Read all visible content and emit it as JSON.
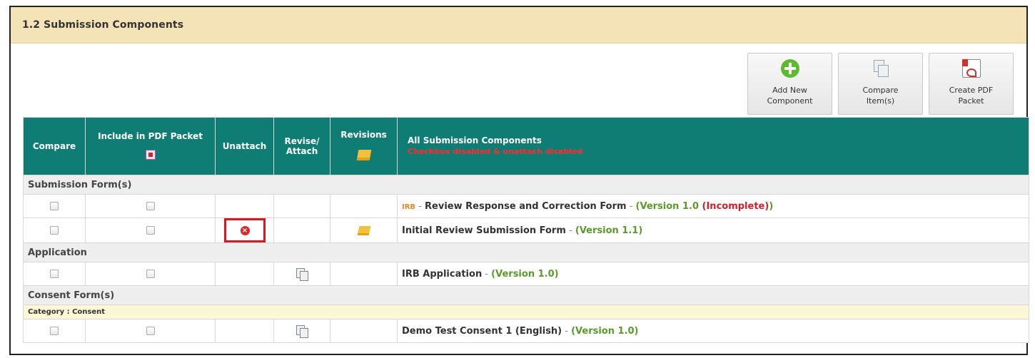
{
  "panel": {
    "title": "1.2  Submission Components"
  },
  "toolbar": {
    "add_new": "Add New Component",
    "compare": "Compare Item(s)",
    "create_pdf": "Create PDF Packet"
  },
  "table": {
    "headers": {
      "compare": "Compare",
      "include_pdf": "Include in PDF Packet",
      "unattach": "Unattach",
      "revise": "Revise/ Attach",
      "revisions": "Revisions",
      "all": "All Submission Components",
      "all_warning": "Checkbox disabled & unattach disabled"
    },
    "sections": [
      {
        "label": "Submission Form(s)"
      },
      {
        "label": "Application"
      },
      {
        "label": "Consent Form(s)"
      }
    ],
    "category_label": "Category : Consent",
    "rows": [
      {
        "tag": "IRB",
        "sep": " - ",
        "name": "Review Response and Correction Form",
        "version": "(Version 1.0",
        "status": "(Incomplete)",
        "close": ")"
      },
      {
        "name": "Initial Review Submission Form",
        "sep": " - ",
        "version": "(Version 1.1)"
      },
      {
        "name": "IRB Application",
        "sep": " - ",
        "version": "(Version 1.0)"
      },
      {
        "name": "Demo Test Consent 1 (English)",
        "sep": " - ",
        "version": "(Version 1.0)"
      }
    ]
  },
  "icons": {
    "add": "plus-circle-icon",
    "compare": "compare-pages-icon",
    "pdf": "pdf-file-icon",
    "unattach": "remove-x-icon",
    "revisions": "folder-icon",
    "revise": "revise-pages-icon"
  },
  "colors": {
    "header_bg": "#f3e3b6",
    "table_head": "#0f7d74",
    "version": "#5a9a2a",
    "incomplete": "#d0202a",
    "highlight": "#e0141e"
  }
}
